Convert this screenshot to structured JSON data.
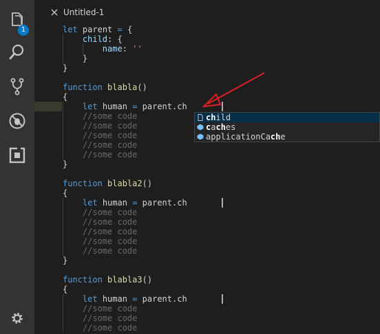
{
  "activity_bar": {
    "items": [
      {
        "name": "explorer",
        "icon": "files-icon",
        "badge": "1"
      },
      {
        "name": "search",
        "icon": "search-icon"
      },
      {
        "name": "source-control",
        "icon": "git-branch-icon"
      },
      {
        "name": "debug",
        "icon": "bug-icon"
      },
      {
        "name": "extensions",
        "icon": "extensions-icon"
      }
    ],
    "settings_icon": "gear-icon"
  },
  "tab": {
    "title": "Untitled-1",
    "close_icon": "close-icon"
  },
  "colors": {
    "keyword": "#569cd6",
    "function_name": "#dcdcaa",
    "property": "#9cdcfe",
    "string": "#ce9178",
    "comment": "#6a6a6a",
    "text": "#d4d4d4",
    "accent": "#007acc",
    "arrow": "#e02020"
  },
  "code": {
    "l1": {
      "kw": "let",
      "name": "parent",
      "op": "=",
      "brace": "{"
    },
    "l2": {
      "prop": "child",
      "colon": ":",
      "brace": "{"
    },
    "l3": {
      "prop": "name",
      "colon": ":",
      "str": "''"
    },
    "l4": "}",
    "l5": "}",
    "functions": [
      {
        "kw": "function",
        "name": "blabla",
        "parens": "()",
        "open": "{",
        "let": "let",
        "var": "human",
        "op": "=",
        "expr": "parent.ch",
        "comment": "//some code",
        "close": "}"
      },
      {
        "kw": "function",
        "name": "blabla2",
        "parens": "()",
        "open": "{",
        "let": "let",
        "var": "human",
        "op": "=",
        "expr": "parent.ch",
        "comment": "//some code",
        "close": "}"
      },
      {
        "kw": "function",
        "name": "blabla3",
        "parens": "()",
        "open": "{",
        "let": "let",
        "var": "human",
        "op": "=",
        "expr": "parent.ch",
        "comment": "//some code"
      }
    ]
  },
  "suggest": {
    "items": [
      {
        "icon": "file-icon",
        "match": "ch",
        "rest": "ild",
        "selected": true
      },
      {
        "icon": "field-icon",
        "prefix": "",
        "match": "c",
        "mid": "a",
        "match2": "ch",
        "rest": "es"
      },
      {
        "icon": "field-icon",
        "prefix": "applicationCa",
        "match": "ch",
        "rest": "e"
      }
    ]
  }
}
